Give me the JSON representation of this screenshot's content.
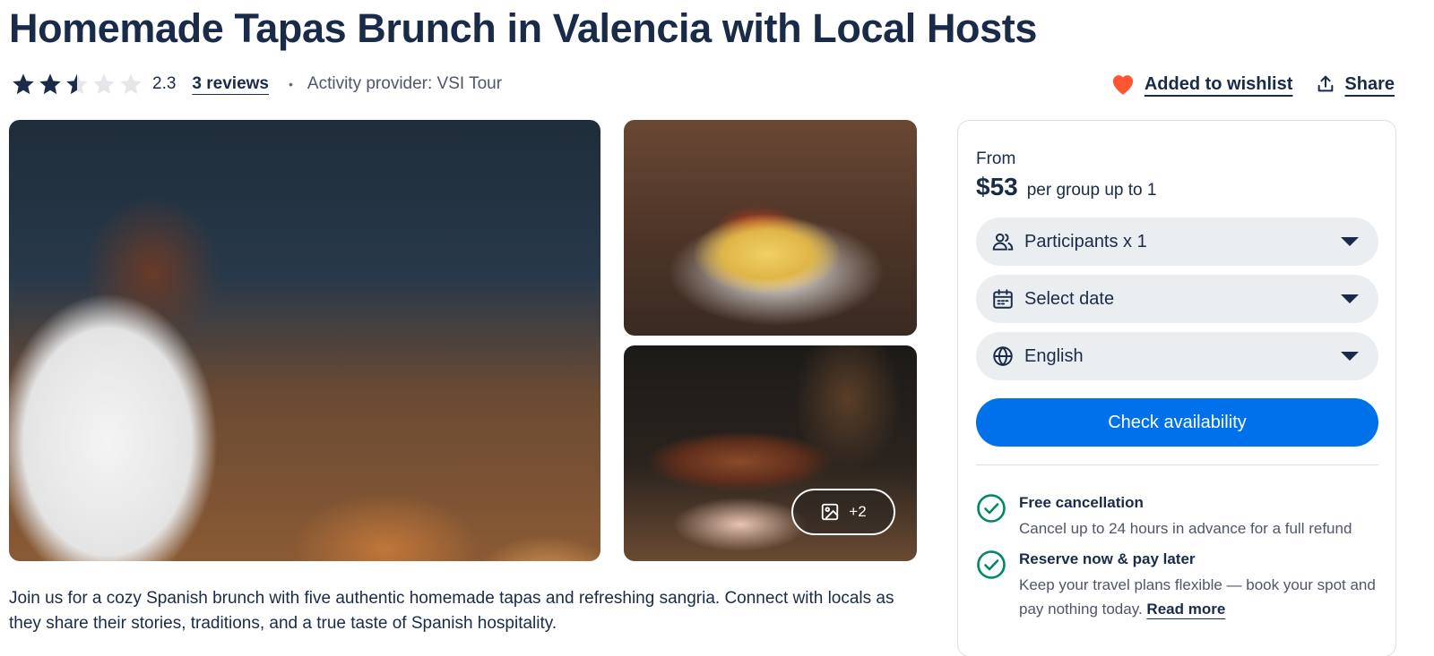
{
  "title": "Homemade Tapas Brunch in Valencia with Local Hosts",
  "rating": {
    "value": "2.3",
    "stars_filled": 2.5,
    "stars_max": 5
  },
  "reviews_link": "3 reviews",
  "separator": "•",
  "provider": "Activity provider: VSI Tour",
  "actions": {
    "wishlist": "Added to wishlist",
    "share": "Share"
  },
  "gallery": {
    "images": [
      "restaurant-group-photo",
      "patatas-bravas-photo",
      "jamon-leg-photo"
    ],
    "more_count": "+2"
  },
  "description": "Join us for a cozy Spanish brunch with five authentic homemade tapas and refreshing sangria. Connect with locals as they share their stories, traditions, and a true taste of Spanish hospitality.",
  "booking": {
    "from_label": "From",
    "price": "$53",
    "price_unit": "per group up to 1",
    "participants": "Participants x 1",
    "date": "Select date",
    "language": "English",
    "cta": "Check availability",
    "features": [
      {
        "title": "Free cancellation",
        "desc": "Cancel up to 24 hours in advance for a full refund"
      },
      {
        "title": "Reserve now & pay later",
        "desc": "Keep your travel plans flexible — book your spot and pay nothing today.",
        "link": "Read more"
      }
    ]
  },
  "colors": {
    "primary": "#0071eb",
    "text": "#1a2b49",
    "heart": "#ff5533",
    "check": "#008768"
  }
}
